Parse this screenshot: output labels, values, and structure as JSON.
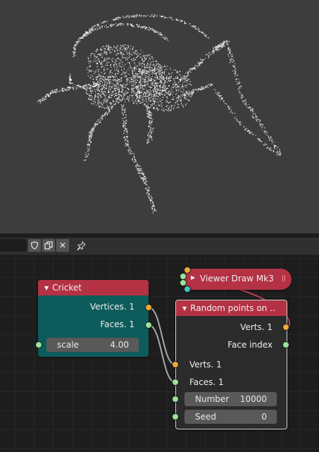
{
  "toolbar": {
    "name_field_value": "",
    "fake_user_icon": "shield-icon",
    "duplicate_icon": "copy-icon",
    "unlink_label": "✕",
    "pin_icon": "pin-icon"
  },
  "nodes": {
    "cricket": {
      "title": "Cricket",
      "vertices_label": "Vertices. 1",
      "faces_label": "Faces. 1",
      "scale_label": "scale",
      "scale_value": "4.00",
      "header_color": "#b43244",
      "body_color": "#0e5b5b"
    },
    "viewer": {
      "title": "Viewer Draw Mk3",
      "header_color": "#b43244"
    },
    "random_points": {
      "title": "Random points on ..",
      "out_verts_label": "Verts. 1",
      "out_face_index_label": "Face index",
      "in_verts_label": "Verts. 1",
      "in_faces_label": "Faces. 1",
      "number_label": "Number",
      "number_value": "10000",
      "seed_label": "Seed",
      "seed_value": "0",
      "body_color": "#2b2b2b"
    }
  },
  "colors": {
    "socket_vertices": "#f0a838",
    "socket_data": "#9be39b",
    "socket_matrix": "#3ec6c6",
    "viewport_bg": "#3d3d3d",
    "editor_bg": "#1d1d1d"
  }
}
